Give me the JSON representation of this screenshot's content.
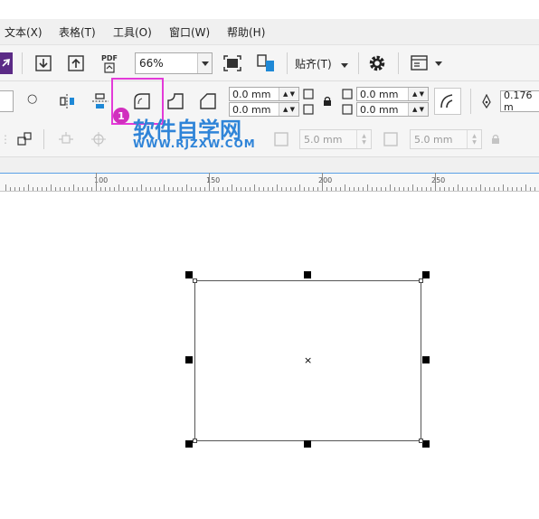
{
  "menu": {
    "items": [
      "文本(X)",
      "表格(T)",
      "工具(O)",
      "窗口(W)",
      "帮助(H)"
    ]
  },
  "toolbar1": {
    "pdf_label": "PDF",
    "zoom_value": "66%",
    "snap_label": "贴齐(T)"
  },
  "toolbar2": {
    "corner_h": "0.0 mm",
    "corner_v": "0.0 mm",
    "corner_h2": "0.0 mm",
    "corner_v2": "0.0 mm",
    "outline_width": "0.176 m"
  },
  "toolbar3": {
    "field1": "5.0 mm",
    "field2": "5.0 mm"
  },
  "ruler": {
    "labels": [
      "100",
      "150",
      "200",
      "250"
    ]
  },
  "annotation": {
    "badge_number": "1",
    "watermark_title": "软件自学网",
    "watermark_url": "WWW.RJZXW.COM"
  },
  "colors": {
    "highlight": "#e33ad8",
    "badge": "#d12fbe",
    "watermark": "#2f84d8",
    "accent_purple": "#5b2a86"
  }
}
